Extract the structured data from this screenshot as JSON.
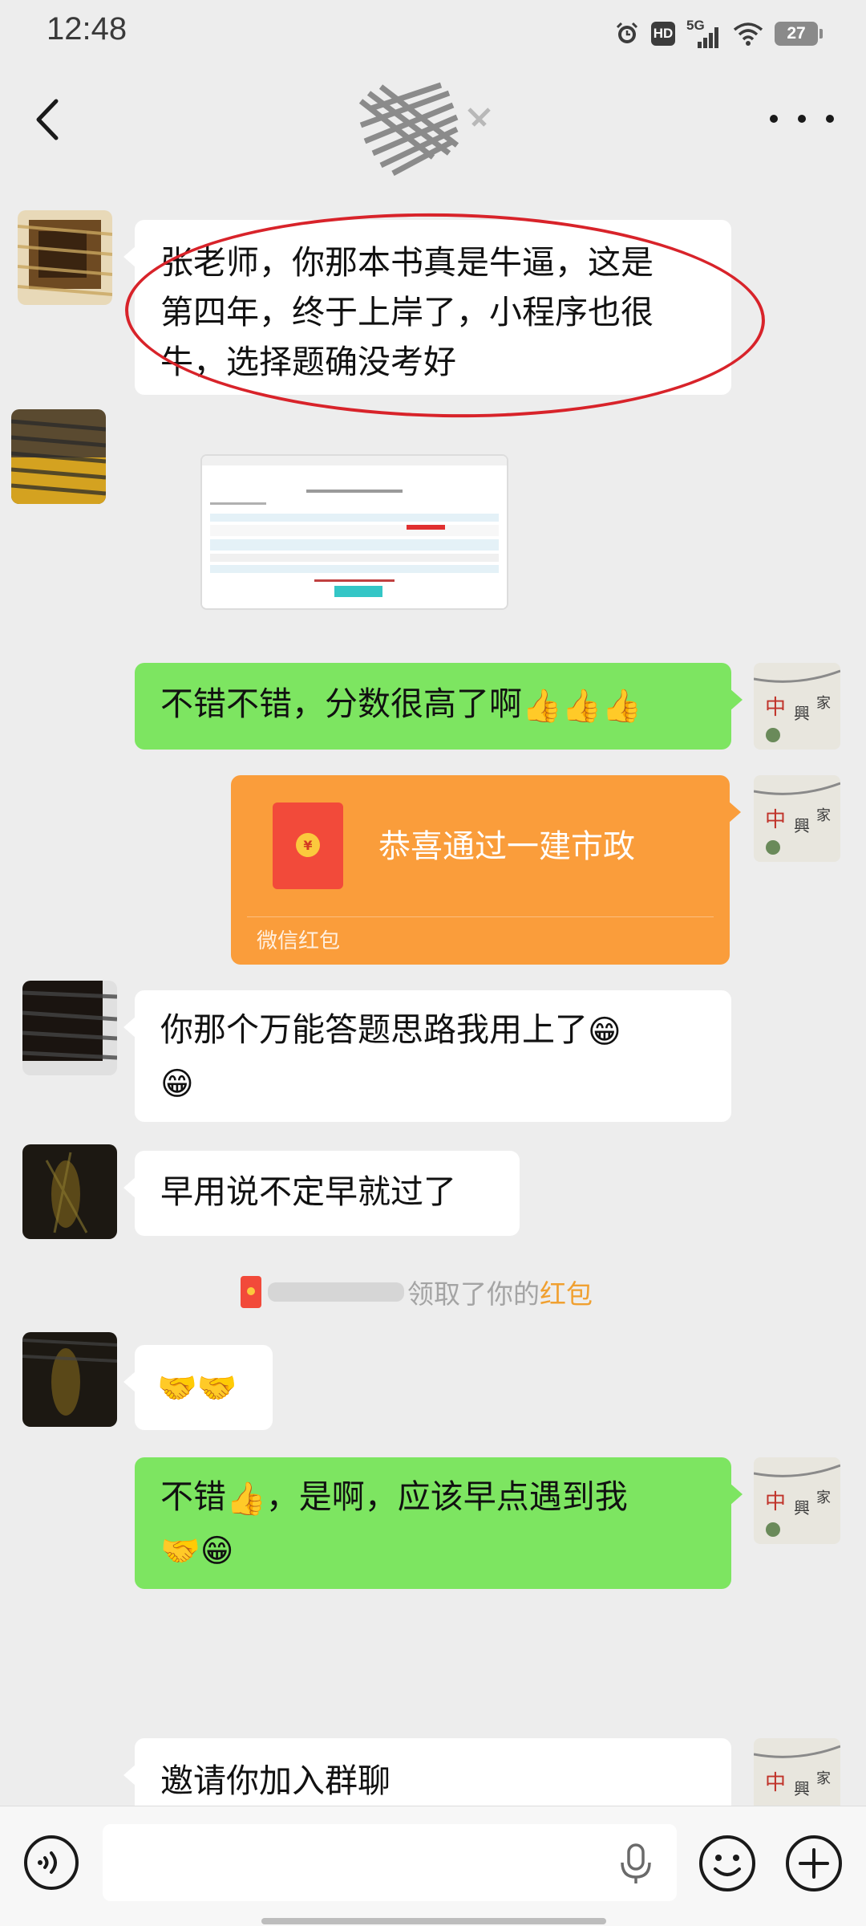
{
  "status_bar": {
    "time": "12:48",
    "hd_label": "HD",
    "network_label": "5G",
    "battery_level": "27"
  },
  "messages": [
    {
      "id": "m1",
      "side": "left",
      "text_lines": [
        "张老师，你那本书真是牛逼，这是",
        "第四年，终于上岸了，小程序也很",
        "牛，选择题确没考好"
      ]
    },
    {
      "id": "m2",
      "side": "left",
      "type": "image"
    },
    {
      "id": "m3",
      "side": "right",
      "text": "不错不错，分数很高了啊",
      "emojis": "👍👍👍"
    },
    {
      "id": "m4",
      "side": "right",
      "type": "red_packet",
      "title": "恭喜通过一建市政",
      "footer": "微信红包"
    },
    {
      "id": "m5",
      "side": "left",
      "text": "你那个万能答题思路我用上了",
      "emoji_inline": "😁",
      "emoji_line2": "😁"
    },
    {
      "id": "m6",
      "side": "left",
      "text": "早用说不定早就过了"
    },
    {
      "id": "m7",
      "side": "left",
      "emojis": "🤝🤝"
    },
    {
      "id": "m8",
      "side": "right",
      "part1": "不错",
      "emoji1": "👍",
      "part2": "，是啊，应该早点遇到我",
      "emojis_line2": "🤝😁"
    },
    {
      "id": "m9",
      "side": "right",
      "text": "邀请你加入群聊"
    }
  ],
  "system_notice": {
    "text": "领取了你的",
    "link": "红包"
  },
  "colors": {
    "background": "#ededed",
    "bubble_self": "#7de561",
    "bubble_other": "#ffffff",
    "red_packet": "#fa9d3b",
    "highlight_ring": "#d8232a"
  },
  "input_bar": {
    "placeholder": ""
  },
  "icons": [
    "back-icon",
    "more-icon",
    "voice-icon",
    "mic-icon",
    "emoji-icon",
    "plus-icon"
  ]
}
